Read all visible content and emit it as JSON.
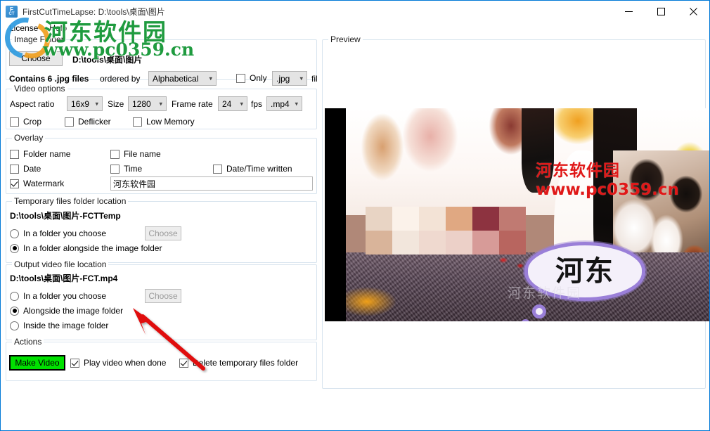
{
  "window": {
    "title": "FirstCutTimeLapse: D:\\tools\\桌面\\图片",
    "icon": "app-icon",
    "minimize": "minimize-icon",
    "maximize": "maximize-icon",
    "close": "close-icon"
  },
  "menu": {
    "items": [
      {
        "label": "License"
      },
      {
        "label": "Help"
      }
    ]
  },
  "image_folder": {
    "legend": "Image Folder",
    "choose_label": "Choose",
    "path": "D:\\tools\\桌面\\图片",
    "contains_label": "Contains 6 .jpg files",
    "ordered_by_label": "ordered by",
    "order_value": "Alphabetical",
    "only_label": "Only",
    "only_checked": false,
    "ext_value": ".jpg",
    "files_label_clipped": "fil"
  },
  "video_options": {
    "legend": "Video options",
    "aspect_ratio_label": "Aspect ratio",
    "aspect_ratio_value": "16x9",
    "size_label": "Size",
    "size_value": "1280",
    "frame_rate_label": "Frame rate",
    "frame_rate_value": "24",
    "fps_label": "fps",
    "format_value": ".mp4",
    "checkboxes": [
      {
        "label": "Crop",
        "checked": false
      },
      {
        "label": "Deflicker",
        "checked": false
      },
      {
        "label": "Low Memory",
        "checked": false
      }
    ]
  },
  "overlay": {
    "legend": "Overlay",
    "checkboxes": [
      {
        "label": "Folder name",
        "checked": false
      },
      {
        "label": "File name",
        "checked": false
      },
      {
        "label": "Date",
        "checked": false
      },
      {
        "label": "Time",
        "checked": false
      },
      {
        "label": "Date/Time written",
        "checked": false
      },
      {
        "label": "Watermark",
        "checked": true
      }
    ],
    "watermark_value": "河东软件园"
  },
  "temp_files": {
    "legend": "Temporary files folder location",
    "path": "D:\\tools\\桌面\\图片-FCTTemp",
    "choose_label": "Choose",
    "choose_disabled": true,
    "options": [
      {
        "label": "In a folder you choose",
        "selected": false
      },
      {
        "label": "In a folder alongside the image folder",
        "selected": true
      }
    ]
  },
  "output_file": {
    "legend": "Output video file location",
    "path": "D:\\tools\\桌面\\图片-FCT.mp4",
    "choose_label": "Choose",
    "choose_disabled": true,
    "options": [
      {
        "label": "In a folder you choose",
        "selected": false
      },
      {
        "label": "Alongside the image folder",
        "selected": true
      },
      {
        "label": "Inside the image folder",
        "selected": false
      }
    ]
  },
  "actions": {
    "legend": "Actions",
    "make_video_label": "Make Video",
    "checkboxes": [
      {
        "label": "Play video when done",
        "checked": true
      },
      {
        "label": "Delete temporary files folder",
        "checked": true
      }
    ]
  },
  "preview": {
    "legend": "Preview",
    "image_watermark_line1": "河东软件园",
    "image_watermark_line2": "www.pc0359.cn",
    "bubble_text": "河东",
    "faint_watermark": "河东软件园"
  },
  "site_watermark": {
    "name": "河东软件园",
    "url": "www.pc0359.cn"
  },
  "annotation": {
    "arrow_color": "#e01010",
    "points_at": "Alongside the image folder"
  }
}
